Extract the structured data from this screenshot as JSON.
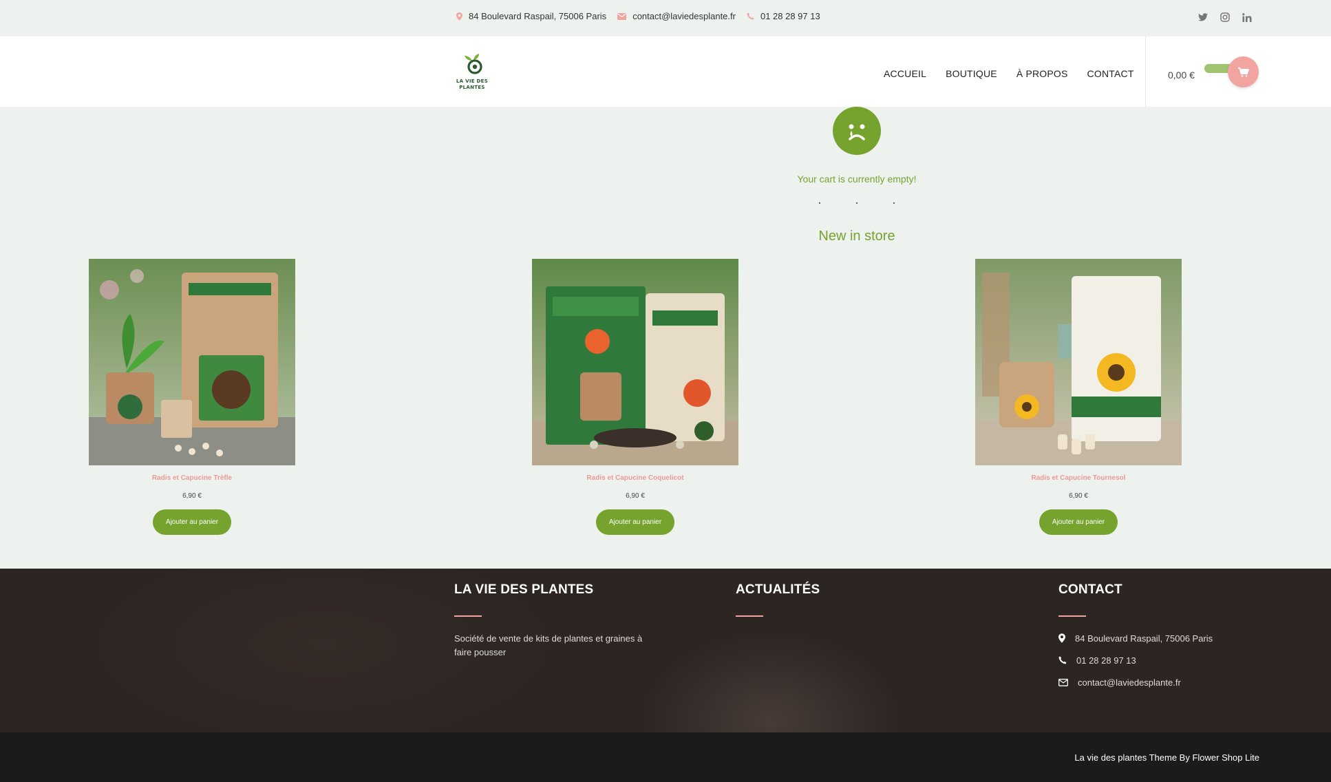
{
  "topbar": {
    "address": "84 Boulevard Raspail, 75006 Paris",
    "email": "contact@laviedesplante.fr",
    "phone": "01 28 28 97 13",
    "social_icons": [
      "twitter-icon",
      "instagram-icon",
      "linkedin-icon"
    ]
  },
  "header": {
    "logo_line1": "LA VIE DES",
    "logo_line2": "PLANTES",
    "nav": [
      "ACCUEIL",
      "BOUTIQUE",
      "À PROPOS",
      "CONTACT"
    ],
    "cart_total": "0,00 €"
  },
  "cart": {
    "empty_message": "Your cart is currently empty!"
  },
  "new_in_store": {
    "title": "New in store",
    "products": [
      {
        "name": "Radis et Capucine Trèfle",
        "price": "6,90 €",
        "button": "Ajouter au panier"
      },
      {
        "name": "Radis et Capucine Coquelicot",
        "price": "6,90 €",
        "button": "Ajouter au panier"
      },
      {
        "name": "Radis et Capucine Tournesol",
        "price": "6,90 €",
        "button": "Ajouter au panier"
      }
    ]
  },
  "footer": {
    "col1_title": "LA VIE DES PLANTES",
    "col1_desc": "Société de vente de kits de plantes et graines à faire pousser",
    "col2_title": "ACTUALITÉS",
    "col3_title": "CONTACT",
    "contact_address": "84 Boulevard Raspail, 75006 Paris",
    "contact_phone": "01 28 28 97 13",
    "contact_email": "contact@laviedesplante.fr",
    "credit": "La vie des plantes Theme By Flower Shop Lite"
  },
  "colors": {
    "accent_green": "#76a22e",
    "accent_pink": "#f1a4a0",
    "page_bg": "#edf2ee",
    "footer_bg": "#2c2522"
  }
}
